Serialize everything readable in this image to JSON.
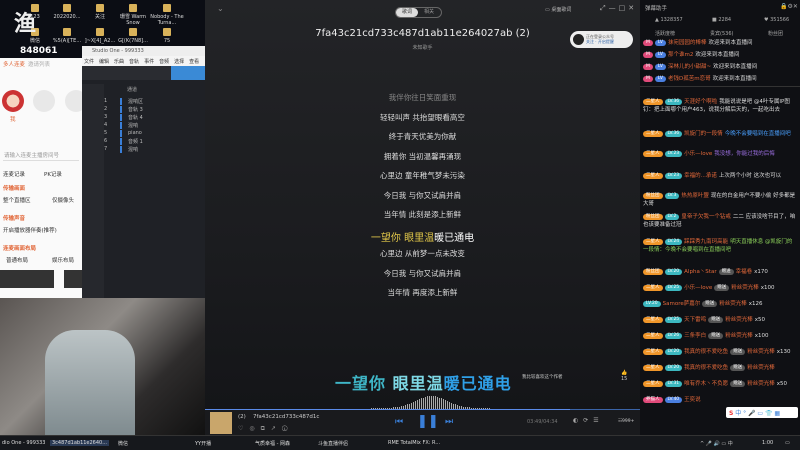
{
  "desktop": {
    "logo_text": "渔",
    "logo_sub": "鼻噶号",
    "room_id": "848061",
    "icons": [
      "123",
      "2022020...",
      "关注",
      "珊雪 Warm Snow",
      "Nobody - The Turna...",
      "斗鱼直播伴侣",
      "微信",
      "%5(A)[TE...",
      "]~X[4]_A2...",
      "G[(K(7N8]...",
      "75"
    ]
  },
  "left_panel": {
    "tabs": [
      "多人连麦",
      "邀请列表"
    ],
    "me_label": "我",
    "input_placeholder": "请输入连麦主播房间号",
    "records": [
      "连麦记录",
      "PK记录"
    ],
    "section_screen": "传输画面",
    "opt_full": "整个直播区",
    "opt_cam": "仅摄像头",
    "section_audio": "传输声音",
    "opt_audio": "开启播放器伴奏(推荐)",
    "section_layout": "连麦画面布局",
    "opt_normal": "普通布局",
    "opt_ent": "娱乐布局"
  },
  "studio": {
    "title": "Studio One - 999333",
    "menu": [
      "文件",
      "编辑",
      "乐曲",
      "音轨",
      "事件",
      "音频",
      "选择",
      "查看"
    ],
    "track_header": "通道",
    "tracks": [
      {
        "n": "1",
        "name": "混响区"
      },
      {
        "n": "2",
        "name": "音轨 3"
      },
      {
        "n": "3",
        "name": "音轨 4"
      },
      {
        "n": "4",
        "name": "混响"
      },
      {
        "n": "5",
        "name": "piano"
      },
      {
        "n": "6",
        "name": "音频 1"
      },
      {
        "n": "7",
        "name": "混响"
      }
    ]
  },
  "player": {
    "seg": [
      "歌词",
      "相关"
    ],
    "toolbar_label": "桌面歌词",
    "song_title": "7fa43c21cd733c487d1ab11e264027ab (2)",
    "artist": "未知歌手",
    "promo": {
      "line1": "正在登录公众号",
      "line2": "关注 · 开启提醒"
    },
    "lyrics": [
      "我伴你往日笑面重现",
      "轻轻叫声 共抬望眼看高空",
      "终于青天优美为你献",
      "拥着你 当初温馨再涌现",
      "心里边 童年稚气梦未污染",
      "今日我 与你又试肩并肩",
      "当年情 此刻是添上新鲜",
      "一望你 眼里温暖已通电",
      "心里边 从前梦一点未改变",
      "今日我 与你又试肩并肩",
      "当年情 再度添上新鲜"
    ],
    "current_sung": "一望你 眼里温",
    "current_rest": "暖已通电",
    "big_lyric": {
      "a": "一望你 ",
      "b": "眼里温",
      "c": "暖已通电"
    },
    "big_note": "我比较喜欢这个作者",
    "like_count": "15",
    "bar": {
      "index": "(2)",
      "title": "7fa43c21cd733c487d1c",
      "time": "03:49/04:34",
      "comments": "999+"
    },
    "progress": 0.84,
    "accent": "#3a64a8"
  },
  "taskbar": {
    "items": [
      "dio One - 999333",
      "3c487d1ab11e2640...",
      "微信",
      "YY开播",
      "气质幸福 - 网森",
      "斗鱼直播伴侣",
      "RME TotalMix FX: R..."
    ],
    "time": "1:00",
    "ime": "中"
  },
  "chat": {
    "title": "弹幕助手",
    "stats": [
      "1328357",
      "2284",
      "351566"
    ],
    "tabs": [
      "活跃度榜",
      "贵宾(536)",
      "粉丝团"
    ],
    "welcome": [
      {
        "name": "抹宛园园的棒棒",
        "text": "欢迎来到本直播间"
      },
      {
        "name": "那个谁m2",
        "text": "欢迎来到本直播间"
      },
      {
        "name": "深林儿的小甜甜~",
        "text": "欢迎来到本直播间"
      },
      {
        "name": "老钱D孤苦m恋哥",
        "text": "欢迎来到本直播间"
      }
    ],
    "messages": [
      {
        "badge": "二星人",
        "lv": "LV.36",
        "name": "天涯好个啊啦",
        "text": "我能说说是吧 @4叶专属IP图钉：把上面哪个用户463，说我分解后天的，一起吃出去"
      },
      {
        "badge": "二星人",
        "lv": "LV.36",
        "name": "凯旋门的一段情",
        "text": "今晚不会要唱到在直播间吧",
        "color": "bu"
      },
      {
        "badge": "二星人",
        "lv": "LV.23",
        "name": "小乐—love",
        "text": "我没想，你能过我的后悔",
        "color": "pu"
      },
      {
        "badge": "二星人",
        "lv": "LV.23",
        "name": "幸福的...承诺",
        "text": "上次两个小时 这次也可以"
      },
      {
        "badge": "粉丝团",
        "lv": "LV.3",
        "name": "热热原叶盟",
        "text": "现在的白金用户不要小偷 好多都是大哥"
      },
      {
        "badge": "粉丝团",
        "lv": "LV.2",
        "name": "皇帝子欠我一个钻戒",
        "text": "二二 应该没啥节目了，咱也该要准备过冠"
      },
      {
        "badge": "二星人",
        "lv": "LV.24",
        "name": "踩踩秀九南珂高能",
        "text": "明天直播休息 @凯旋门的一段情：今晚不会要唱到在直播间吧",
        "color": "g"
      }
    ],
    "gifts": [
      {
        "badge": "粉丝团",
        "lv": "LV.20",
        "name": "Alpha丶Star",
        "verb": "赠送",
        "gift": "幸福卷",
        "count": "x170"
      },
      {
        "badge": "二星人",
        "lv": "LV.25",
        "name": "小乐—love",
        "verb": "赠送",
        "gift": "粉丝荧光棒",
        "count": "x100"
      },
      {
        "badge": "",
        "lv": "LV.20",
        "name": "Samore萨嘉尔",
        "verb": "赠送",
        "gift": "粉丝荧光棒",
        "count": "x126"
      },
      {
        "badge": "二星人",
        "lv": "LV.25",
        "name": "天下雷鸣",
        "verb": "赠送",
        "gift": "粉丝荧光棒",
        "count": "x50"
      },
      {
        "badge": "二星人",
        "lv": "LV.26",
        "name": "三条李白",
        "verb": "赠送",
        "gift": "粉丝荧光棒",
        "count": "x100"
      },
      {
        "badge": "二星人",
        "lv": "LV.20",
        "name": "我真的很不爱吃鱼",
        "verb": "赠送",
        "gift": "粉丝荧光棒",
        "count": "x130"
      },
      {
        "badge": "二星人",
        "lv": "LV.20",
        "name": "我真的很不爱吃鱼",
        "verb": "赠送",
        "gift": "粉丝荧光棒",
        "count": ""
      },
      {
        "badge": "二星人",
        "lv": "LV.31",
        "name": "唯有乔木丶不负愿",
        "verb": "赠送",
        "gift": "粉丝荧光棒",
        "count": "x50"
      },
      {
        "badge": "养猫人",
        "lv": "LV.40",
        "name": "王奕说",
        "verb": "",
        "gift": "",
        "count": ""
      }
    ]
  }
}
